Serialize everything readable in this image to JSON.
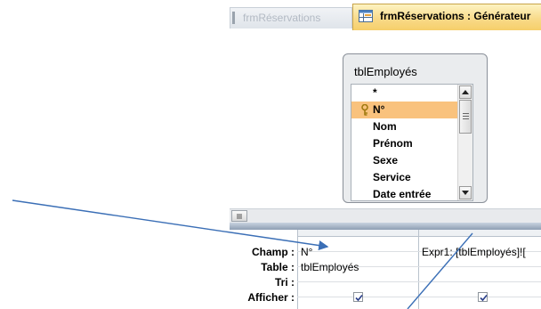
{
  "tabs": [
    {
      "label": "frmRéservations",
      "active": false
    },
    {
      "label": "frmRéservations : Générateur",
      "active": true
    }
  ],
  "table": {
    "title": "tblEmployés",
    "fields": [
      "*",
      "N°",
      "Nom",
      "Prénom",
      "Sexe",
      "Service",
      "Date entrée"
    ],
    "selected_field": "N°"
  },
  "grid": {
    "row_labels": {
      "champ": "Champ :",
      "table": "Table :",
      "tri": "Tri :",
      "afficher": "Afficher :"
    },
    "columns": [
      {
        "champ": "N°",
        "table": "tblEmployés",
        "tri": "",
        "afficher": true
      },
      {
        "champ": "Expr1: [tblEmployés]![",
        "table": "",
        "tri": "",
        "afficher": true
      }
    ]
  },
  "colors": {
    "selected_field": "#f9c27d",
    "annotation_arrow": "#3b6fb6",
    "active_tab": "#f8d986"
  }
}
